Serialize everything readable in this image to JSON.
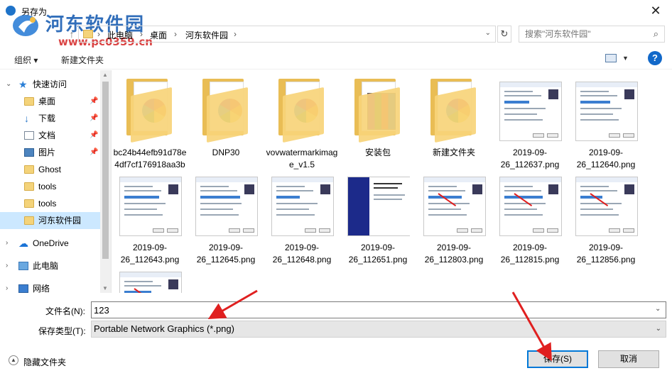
{
  "window": {
    "title": "另存为",
    "close_glyph": "✕"
  },
  "watermark": {
    "name": "河东软件园",
    "url": "www.pc0359.cn"
  },
  "address": {
    "crumbs": [
      "此电脑",
      "桌面",
      "河东软件园"
    ],
    "separator": "›",
    "dropdown_glyph": "⌄",
    "refresh_glyph": "↻"
  },
  "search": {
    "placeholder": "搜索\"河东软件园\"",
    "icon": "search-icon"
  },
  "toolbar": {
    "organize_label": "组织 ▾",
    "new_folder_label": "新建文件夹",
    "help_label": "?"
  },
  "nav": {
    "quick_access": "快速访问",
    "items": [
      {
        "label": "桌面",
        "icon": "folder-icon",
        "pinned": true
      },
      {
        "label": "下载",
        "icon": "download-icon",
        "pinned": true
      },
      {
        "label": "文档",
        "icon": "document-icon",
        "pinned": true
      },
      {
        "label": "图片",
        "icon": "pictures-icon",
        "pinned": true
      },
      {
        "label": "Ghost",
        "icon": "folder-icon",
        "pinned": false
      },
      {
        "label": "tools",
        "icon": "folder-icon",
        "pinned": false
      },
      {
        "label": "tools",
        "icon": "folder-icon",
        "pinned": false
      },
      {
        "label": "河东软件园",
        "icon": "folder-icon",
        "pinned": false,
        "selected": true
      }
    ],
    "onedrive": "OneDrive",
    "this_pc": "此电脑",
    "network": "网络",
    "pin_glyph": "📌"
  },
  "files": [
    {
      "name": "bc24b44efb91d78e4df7cf176918aa3b",
      "kind": "folder"
    },
    {
      "name": "DNP30",
      "kind": "folder"
    },
    {
      "name": "vovwatermarkimage_v1.5",
      "kind": "folder"
    },
    {
      "name": "安装包",
      "kind": "folder-rar"
    },
    {
      "name": "新建文件夹",
      "kind": "folder"
    },
    {
      "name": "2019-09-26_112637.png",
      "kind": "image"
    },
    {
      "name": "2019-09-26_112640.png",
      "kind": "image"
    },
    {
      "name": "2019-09-26_112643.png",
      "kind": "image"
    },
    {
      "name": "2019-09-26_112645.png",
      "kind": "image"
    },
    {
      "name": "2019-09-26_112648.png",
      "kind": "image"
    },
    {
      "name": "2019-09-26_112651.png",
      "kind": "image-dark"
    },
    {
      "name": "2019-09-26_112803.png",
      "kind": "image"
    },
    {
      "name": "2019-09-26_112815.png",
      "kind": "image"
    },
    {
      "name": "2019-09-26_112856.png",
      "kind": "image"
    },
    {
      "name": "",
      "kind": "image"
    }
  ],
  "form": {
    "filename_label": "文件名(N):",
    "filename_value": "123",
    "filetype_label": "保存类型(T):",
    "filetype_value": "Portable Network Graphics (*.png)"
  },
  "footer": {
    "hide_folders_label": "隐藏文件夹",
    "save_label": "保存(S)",
    "cancel_label": "取消"
  },
  "colors": {
    "accent": "#0078d7",
    "selection": "#cce8ff",
    "annotation_arrow": "#e02020"
  }
}
